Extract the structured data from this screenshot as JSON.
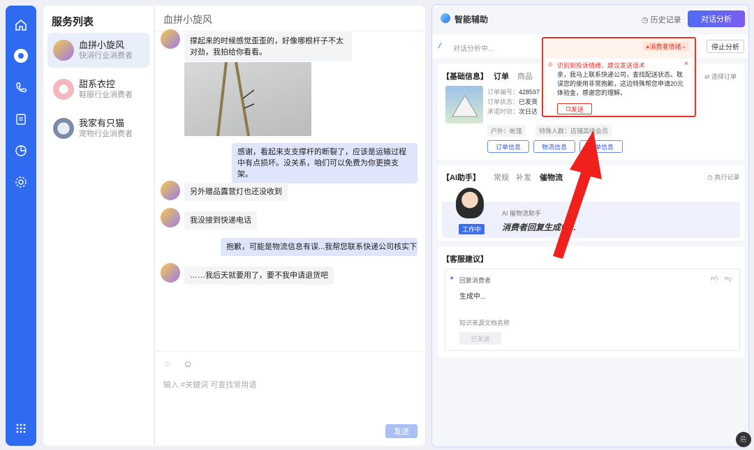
{
  "rail": {
    "icons": [
      "home-icon",
      "chat-icon",
      "phone-icon",
      "clipboard-icon",
      "pie-chart-icon",
      "settings-icon",
      "apps-grid-icon"
    ]
  },
  "services": {
    "title": "服务列表",
    "items": [
      {
        "name": "血拼小旋风",
        "sub": "快消行业消费者"
      },
      {
        "name": "甜系衣控",
        "sub": "鞋服行业消费者"
      },
      {
        "name": "我家有只猫",
        "sub": "宠物行业消费者"
      }
    ]
  },
  "chat": {
    "title": "血拼小旋风",
    "messages": [
      {
        "side": "left",
        "text": "撑起来的时候感觉歪歪的，好像哪根杆子不太对劲，我拍给你看看。"
      },
      {
        "side": "right",
        "text": "感谢，看起来支支撑杆的断裂了，应该是运输过程中有点损坏。没关系，咱们可以免费为你更换支架。"
      },
      {
        "side": "left",
        "text": "另外赠品露营灯也还没收到"
      },
      {
        "side": "left",
        "text": "我没接到快递电话"
      },
      {
        "side": "right",
        "text": "抱歉，可能是物流信息有误...我帮您联系快递公司核实下..."
      },
      {
        "side": "left",
        "text": "……我后天就要用了，要不我申请退货吧"
      }
    ],
    "input_placeholder": "输入 #关键词 可查找常用语",
    "send": "发送"
  },
  "assist": {
    "title": "智能辅助",
    "history": "历史记录",
    "analyze": "对话分析",
    "analyzing": "对话分析中...",
    "stop": "停止分析",
    "emotion_tag": "消费者情绪",
    "alert_title": "识别到投诉情绪，建议发送话术",
    "alert_text": "亲，我马上联系快递公司，查找配送状态。耽误您的使用非常抱歉，这边特殊帮您申请20元体验金，感谢您的理解。",
    "alert_send": "发送",
    "basic": {
      "section": "【基础信息】",
      "tab_order": "订单",
      "tab_goods": "商品",
      "choose": "选择订单",
      "order_no_label": "订单编号：",
      "order_no": "428597",
      "status_label": "订单状态：",
      "status": "已发货",
      "promise_label": "承诺时效：",
      "promise": "次日达",
      "tag_outdoor": "户外：帐篷",
      "tag_crowd": "特殊人群：店铺高级会员",
      "btn_order": "订单信息",
      "btn_logistics": "物流信息",
      "btn_more": "催单信息"
    },
    "ai": {
      "section": "【AI助手】",
      "tabs": [
        "常规",
        "补发",
        "催物流"
      ],
      "exec": "执行记录",
      "assistant": "AI 催物流助手",
      "working": "工作中",
      "status": "消费者回复生成中..."
    },
    "suggest": {
      "section": "【客服建议】",
      "reply": "回复消费者",
      "generating": "生成中...",
      "kb": "知识来源文档名称",
      "sent": "已发送"
    }
  }
}
